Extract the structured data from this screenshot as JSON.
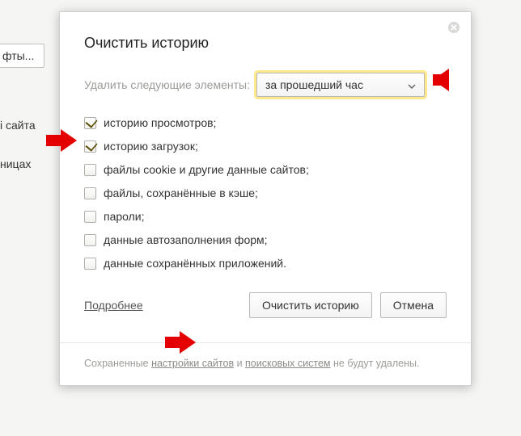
{
  "bg": {
    "btn": "фты...",
    "t1": "і сайта",
    "t2": "ницах"
  },
  "dialog": {
    "title": "Очистить историю",
    "period_label": "Удалить следующие элементы:",
    "period_value": "за прошедший час",
    "options": [
      {
        "label": "историю просмотров;",
        "checked": true
      },
      {
        "label": "историю загрузок;",
        "checked": true
      },
      {
        "label": "файлы cookie и другие данные сайтов;",
        "checked": false
      },
      {
        "label": "файлы, сохранённые в кэше;",
        "checked": false
      },
      {
        "label": "пароли;",
        "checked": false
      },
      {
        "label": "данные автозаполнения форм;",
        "checked": false
      },
      {
        "label": "данные сохранённых приложений.",
        "checked": false
      }
    ],
    "more": "Подробнее",
    "clear_btn": "Очистить историю",
    "cancel_btn": "Отмена",
    "footer_1": "Сохраненные ",
    "footer_2": "настройки сайтов",
    "footer_3": " и ",
    "footer_4": "поисковых систем",
    "footer_5": " не будут удалены."
  }
}
